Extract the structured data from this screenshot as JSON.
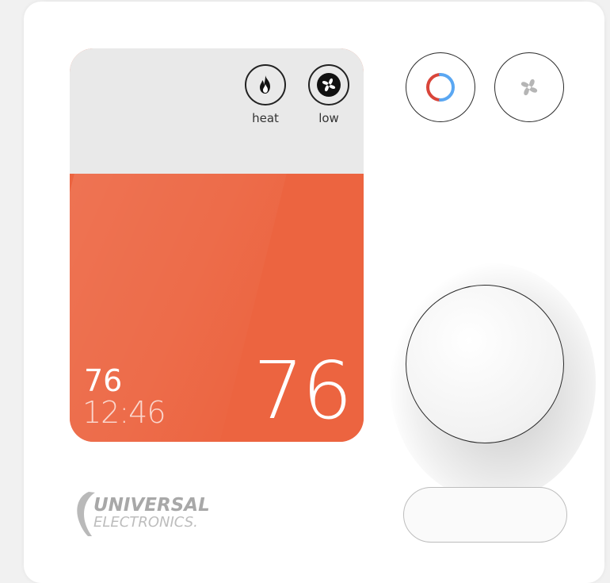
{
  "screen": {
    "heat_label": "heat",
    "fan_label": "low",
    "setpoint": "76",
    "clock": "12:46",
    "current_temp": "76"
  },
  "brand": {
    "line1": "UNIVERSAL",
    "line2": "ELECTRONICS."
  },
  "icons": {
    "heat_indicator": "flame-icon",
    "fan_indicator": "fan-icon",
    "mode_button": "mode-ring-icon",
    "fan_button": "fan-icon"
  },
  "colors": {
    "display_orange": "#ec6440",
    "display_gray": "#e9e9e9",
    "mode_red": "#d9453a",
    "mode_blue": "#5aa7f2"
  }
}
